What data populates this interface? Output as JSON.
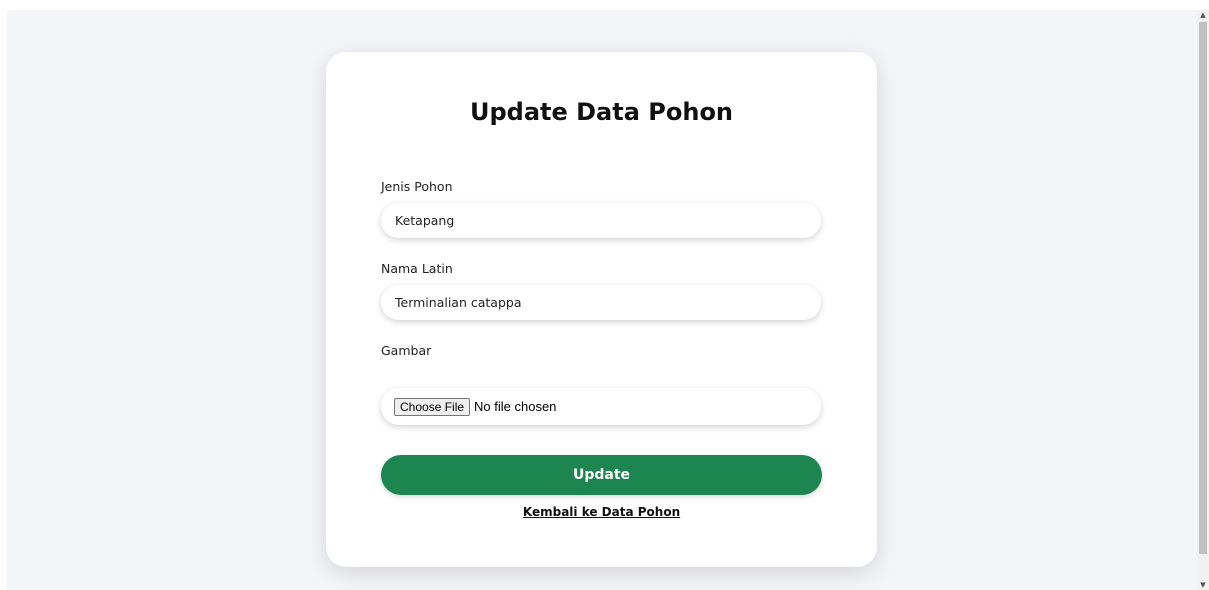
{
  "form": {
    "title": "Update Data Pohon",
    "fields": [
      {
        "label": "Jenis Pohon",
        "value": "Ketapang"
      },
      {
        "label": "Nama Latin",
        "value": "Terminalian catappa"
      },
      {
        "label": "Gambar",
        "button_label": "Choose File",
        "status": "No file chosen"
      }
    ],
    "submit_label": "Update",
    "back_link": "Kembali ke Data Pohon"
  },
  "colors": {
    "accent": "#1c8550",
    "page_background": "#f4f5f9"
  }
}
